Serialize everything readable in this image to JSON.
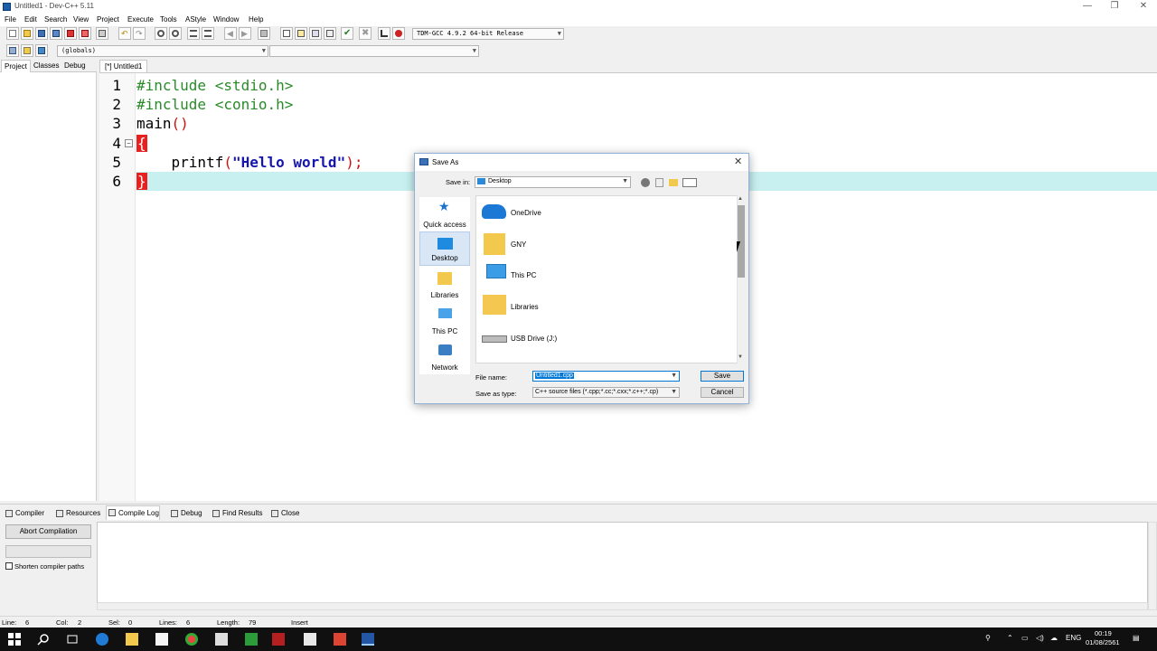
{
  "window": {
    "title": "Untitled1 - Dev-C++ 5.11",
    "controls": [
      "—",
      "❐",
      "✕"
    ]
  },
  "menu": [
    "File",
    "Edit",
    "Search",
    "View",
    "Project",
    "Execute",
    "Tools",
    "AStyle",
    "Window",
    "Help"
  ],
  "toolbar": {
    "compiler": "TDM-GCC 4.9.2 64-bit Release",
    "scope": "(globals)",
    "members": ""
  },
  "left_tabs": [
    "Project",
    "Classes",
    "Debug"
  ],
  "editor": {
    "tab": "[*] Untitled1",
    "line_numbers": [
      "1",
      "2",
      "3",
      "4",
      "5",
      "6"
    ],
    "code": {
      "l1": "#include <stdio.h>",
      "l2": "#include <conio.h>",
      "l3a": "main",
      "l3b": "()",
      "l4": "{",
      "l5a": "    printf",
      "l5b": "(",
      "l5c": "\"Hello world\"",
      "l5d": ");",
      "l6": "}"
    }
  },
  "bottom_tabs": [
    "Compiler",
    "Resources",
    "Compile Log",
    "Debug",
    "Find Results",
    "Close"
  ],
  "bottom_panel": {
    "abort_button": "Abort Compilation",
    "shorten_label": "Shorten compiler paths"
  },
  "status": {
    "line_label": "Line:",
    "line_value": "6",
    "col_label": "Col:",
    "col_value": "2",
    "sel_label": "Sel:",
    "sel_value": "0",
    "lines_label": "Lines:",
    "lines_value": "6",
    "length_label": "Length:",
    "length_value": "79",
    "mode": "Insert"
  },
  "dialog": {
    "title": "Save As",
    "save_in_label": "Save in:",
    "save_in_value": "Desktop",
    "places": [
      "Quick access",
      "Desktop",
      "Libraries",
      "This PC",
      "Network"
    ],
    "files": [
      "OneDrive",
      "GNY",
      "This PC",
      "Libraries",
      "USB Drive (J:)"
    ],
    "file_name_label": "File name:",
    "file_name_value": "Untitled1.cpp",
    "save_as_type_label": "Save as type:",
    "save_as_type_value": "C++ source files (*.cpp;*.cc;*.cxx;*.c++;*.cp)",
    "save_button": "Save",
    "cancel_button": "Cancel"
  },
  "taskbar": {
    "lang": "ENG",
    "time": "00:19",
    "date": "01/08/2561"
  },
  "colors": {
    "accent": "#0078d7",
    "current_line": "#c8f0f0",
    "keyword_green": "#2a8a2a",
    "paren_red": "#cc1111",
    "string_blue": "#1515b0"
  }
}
